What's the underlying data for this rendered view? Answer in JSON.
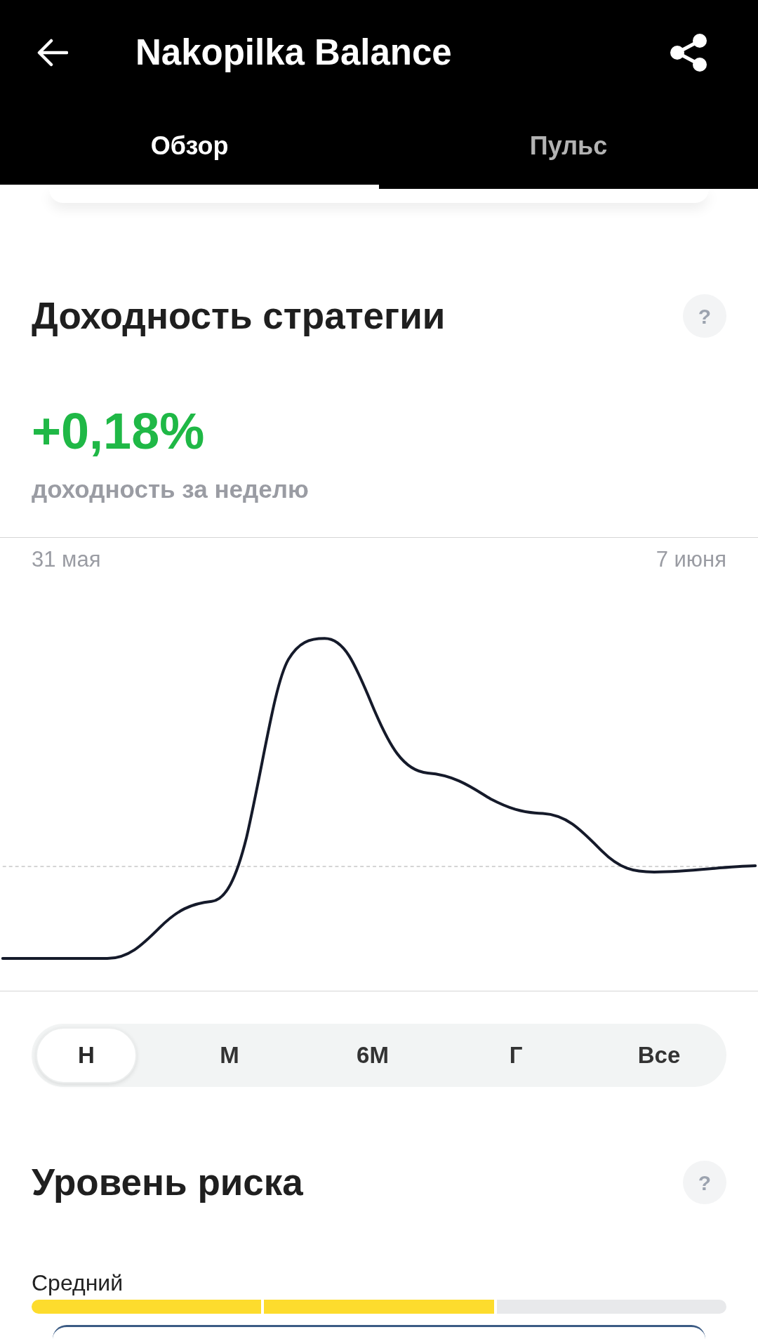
{
  "header": {
    "title": "Nakopilka Balance",
    "tabs": [
      {
        "label": "Обзор",
        "selected": true
      },
      {
        "label": "Пульс",
        "selected": false
      }
    ]
  },
  "strategy_yield": {
    "title": "Доходность стратегии",
    "help": "?",
    "value": "+0,18%",
    "caption": "доходность за неделю",
    "chart": {
      "start_label": "31 мая",
      "end_label": "7 июня"
    },
    "periods": [
      {
        "label": "Н",
        "selected": true
      },
      {
        "label": "М",
        "selected": false
      },
      {
        "label": "6М",
        "selected": false
      },
      {
        "label": "Г",
        "selected": false
      },
      {
        "label": "Все",
        "selected": false
      }
    ]
  },
  "risk": {
    "title": "Уровень риска",
    "help": "?",
    "label": "Средний",
    "segments": [
      {
        "filled": true
      },
      {
        "filled": true
      },
      {
        "filled": false
      }
    ]
  }
}
